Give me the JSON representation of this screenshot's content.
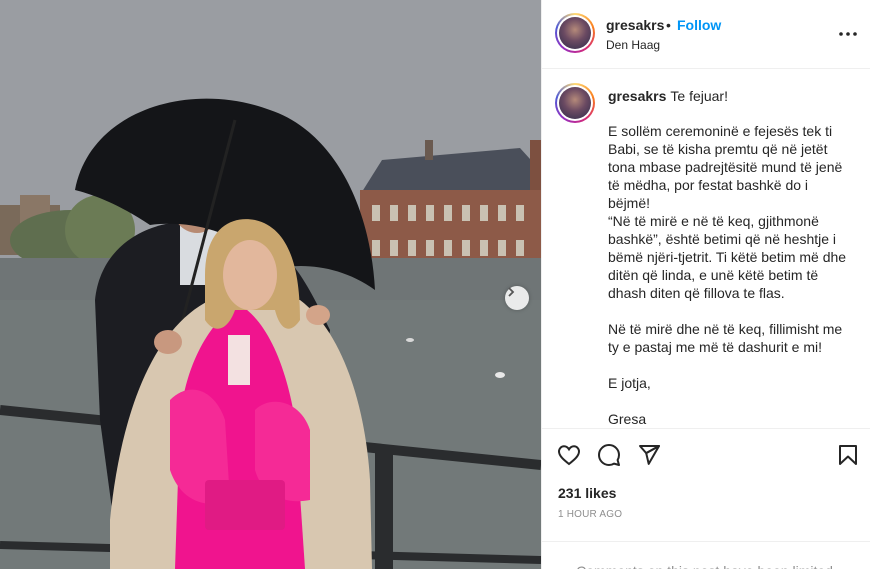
{
  "post": {
    "username": "gresakrs",
    "follow_label": "Follow",
    "separator": "•",
    "location": "Den Haag",
    "caption_title": "Te fejuar!",
    "caption_paragraphs": [
      "E sollëm ceremoninë e fejesës tek ti Babi, se të kisha premtu që në jetët tona mbase padrejtësitë mund të jenë të mëdha, por festat bashkë do i bëjmë!",
      "“Në të mirë e në të keq, gjithmonë bashkë”, është betimi që në heshtje i bëmë njëri-tjetrit. Ti këtë betim më dhe ditën që linda, e unë këtë betim të dhash diten që fillova te flas.",
      "Në të mirë dhe në të keq, fillimisht me ty e pastaj me më të dashurit e mi!",
      "E jotja,",
      "Gresa"
    ],
    "likes_text": "231 likes",
    "time_text": "1 HOUR AGO",
    "comments_limited_text": "Comments on this post have been limited."
  },
  "icons": {
    "more": "more-options-icon",
    "like": "heart-icon",
    "comment": "comment-icon",
    "share": "paper-plane-icon",
    "save": "bookmark-icon",
    "next": "chevron-right-icon"
  },
  "colors": {
    "follow_blue": "#0095f6",
    "text": "#262626",
    "muted": "#8e8e8e",
    "divider": "#efefef"
  }
}
